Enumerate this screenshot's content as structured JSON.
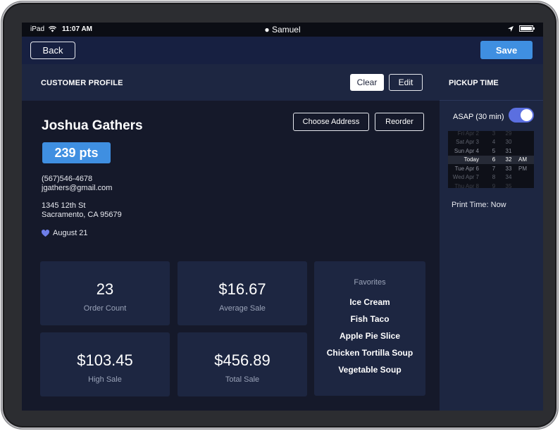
{
  "status_bar": {
    "device": "iPad",
    "time": "11:07 AM",
    "user": "Samuel"
  },
  "nav": {
    "back_label": "Back",
    "save_label": "Save"
  },
  "profile": {
    "header_title": "CUSTOMER PROFILE",
    "clear_label": "Clear",
    "edit_label": "Edit",
    "choose_address_label": "Choose Address",
    "reorder_label": "Reorder",
    "name": "Joshua Gathers",
    "points": "239 pts",
    "phone": "(567)546-4678",
    "email": "jgathers@gmail.com",
    "street": "1345 12th St",
    "city": "Sacramento, CA 95679",
    "birthday": "August 21"
  },
  "stats": [
    {
      "value": "23",
      "label": "Order Count"
    },
    {
      "value": "$16.67",
      "label": "Average Sale"
    },
    {
      "value": "$103.45",
      "label": "High Sale"
    },
    {
      "value": "$456.89",
      "label": "Total Sale"
    }
  ],
  "favorites": {
    "title": "Favorites",
    "items": [
      "Ice Cream",
      "Fish Taco",
      "Apple Pie Slice",
      "Chicken Tortilla Soup",
      "Vegetable Soup"
    ]
  },
  "pickup": {
    "header_title": "PICKUP TIME",
    "asap_label": "ASAP (30 min)",
    "asap_enabled": true,
    "picker_rows": [
      {
        "day": "Fri Apr 2",
        "hour": "3",
        "minute": "29",
        "ampm": ""
      },
      {
        "day": "Sat Apr 3",
        "hour": "4",
        "minute": "30",
        "ampm": ""
      },
      {
        "day": "Sun Apr 4",
        "hour": "5",
        "minute": "31",
        "ampm": ""
      },
      {
        "day": "Today",
        "hour": "6",
        "minute": "32",
        "ampm": "AM"
      },
      {
        "day": "Tue Apr 6",
        "hour": "7",
        "minute": "33",
        "ampm": "PM"
      },
      {
        "day": "Wed Apr 7",
        "hour": "8",
        "minute": "34",
        "ampm": ""
      },
      {
        "day": "Thu Apr 8",
        "hour": "9",
        "minute": "35",
        "ampm": ""
      }
    ],
    "selected_index": 3,
    "print_time": "Print Time: Now"
  },
  "colors": {
    "accent_blue": "#3f8fe1",
    "toggle_on": "#5b6fe0",
    "heart": "#6e7ee8"
  }
}
